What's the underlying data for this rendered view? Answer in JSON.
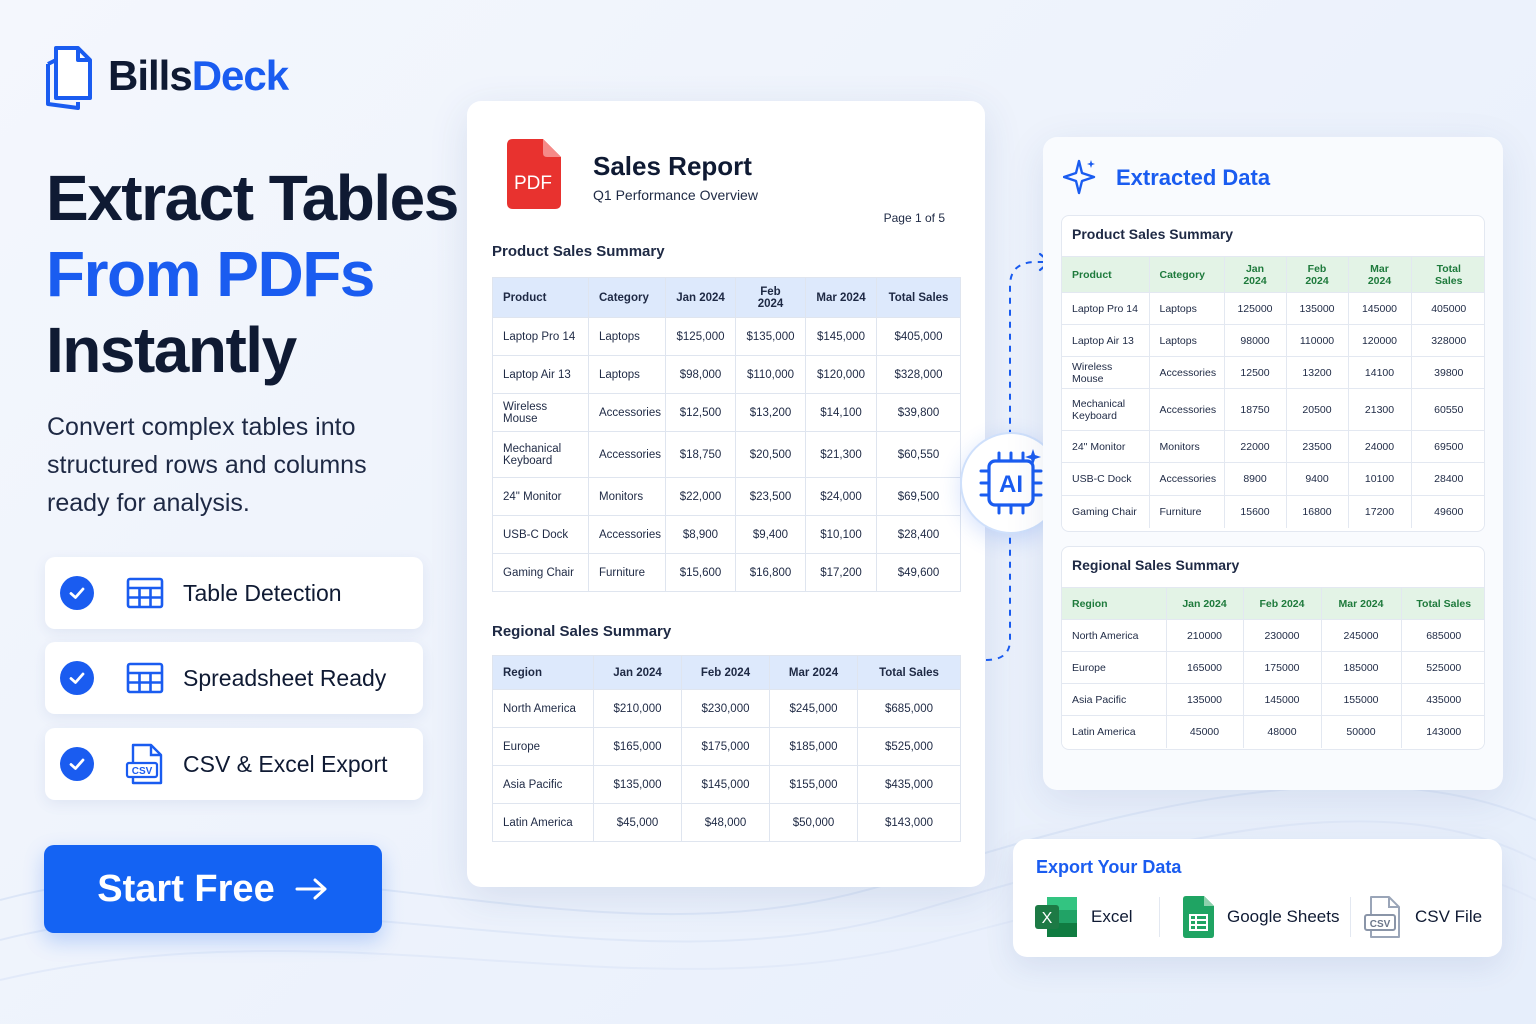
{
  "brand": {
    "name_part1": "Bills",
    "name_part2": "Deck"
  },
  "hero": {
    "line1": "Extract Tables",
    "line2": "From PDFs",
    "line3": "Instantly",
    "subtitle": "Convert complex tables into structured rows and columns ready for analysis."
  },
  "features": [
    {
      "label": "Table Detection",
      "icon": "table-icon"
    },
    {
      "label": "Spreadsheet Ready",
      "icon": "table-icon"
    },
    {
      "label": "CSV & Excel Export",
      "icon": "csv-file-icon",
      "icon_text": "CSV"
    }
  ],
  "cta": {
    "label": "Start Free"
  },
  "pdf": {
    "icon_text": "PDF",
    "title": "Sales Report",
    "subtitle": "Q1 Performance Overview",
    "page": "Page 1 of 5",
    "product_title": "Product Sales Summary",
    "product_headers": [
      "Product",
      "Category",
      "Jan 2024",
      "Feb 2024",
      "Mar 2024",
      "Total Sales"
    ],
    "product_rows": [
      [
        "Laptop Pro 14",
        "Laptops",
        "$125,000",
        "$135,000",
        "$145,000",
        "$405,000"
      ],
      [
        "Laptop Air 13",
        "Laptops",
        "$98,000",
        "$110,000",
        "$120,000",
        "$328,000"
      ],
      [
        "Wireless Mouse",
        "Accessories",
        "$12,500",
        "$13,200",
        "$14,100",
        "$39,800"
      ],
      [
        "Mechanical Keyboard",
        "Accessories",
        "$18,750",
        "$20,500",
        "$21,300",
        "$60,550"
      ],
      [
        "24\" Monitor",
        "Monitors",
        "$22,000",
        "$23,500",
        "$24,000",
        "$69,500"
      ],
      [
        "USB-C Dock",
        "Accessories",
        "$8,900",
        "$9,400",
        "$10,100",
        "$28,400"
      ],
      [
        "Gaming Chair",
        "Furniture",
        "$15,600",
        "$16,800",
        "$17,200",
        "$49,600"
      ]
    ],
    "regional_title": "Regional Sales Summary",
    "regional_headers": [
      "Region",
      "Jan 2024",
      "Feb 2024",
      "Mar 2024",
      "Total Sales"
    ],
    "regional_rows": [
      [
        "North America",
        "$210,000",
        "$230,000",
        "$245,000",
        "$685,000"
      ],
      [
        "Europe",
        "$165,000",
        "$175,000",
        "$185,000",
        "$525,000"
      ],
      [
        "Asia Pacific",
        "$135,000",
        "$145,000",
        "$155,000",
        "$435,000"
      ],
      [
        "Latin America",
        "$45,000",
        "$48,000",
        "$50,000",
        "$143,000"
      ]
    ]
  },
  "ai_badge": {
    "label": "AI"
  },
  "extracted": {
    "title": "Extracted Data",
    "product_title": "Product Sales Summary",
    "product_headers": [
      "Product",
      "Category",
      "Jan 2024",
      "Feb 2024",
      "Mar 2024",
      "Total Sales"
    ],
    "product_rows": [
      [
        "Laptop Pro 14",
        "Laptops",
        "125000",
        "135000",
        "145000",
        "405000"
      ],
      [
        "Laptop Air 13",
        "Laptops",
        "98000",
        "110000",
        "120000",
        "328000"
      ],
      [
        "Wireless Mouse",
        "Accessories",
        "12500",
        "13200",
        "14100",
        "39800"
      ],
      [
        "Mechanical Keyboard",
        "Accessories",
        "18750",
        "20500",
        "21300",
        "60550"
      ],
      [
        "24\" Monitor",
        "Monitors",
        "22000",
        "23500",
        "24000",
        "69500"
      ],
      [
        "USB-C Dock",
        "Accessories",
        "8900",
        "9400",
        "10100",
        "28400"
      ],
      [
        "Gaming Chair",
        "Furniture",
        "15600",
        "16800",
        "17200",
        "49600"
      ]
    ],
    "regional_title": "Regional Sales Summary",
    "regional_headers": [
      "Region",
      "Jan 2024",
      "Feb 2024",
      "Mar 2024",
      "Total Sales"
    ],
    "regional_rows": [
      [
        "North America",
        "210000",
        "230000",
        "245000",
        "685000"
      ],
      [
        "Europe",
        "165000",
        "175000",
        "185000",
        "525000"
      ],
      [
        "Asia Pacific",
        "135000",
        "145000",
        "155000",
        "435000"
      ],
      [
        "Latin America",
        "45000",
        "48000",
        "50000",
        "143000"
      ]
    ]
  },
  "export": {
    "title": "Export Your Data",
    "items": [
      {
        "label": "Excel",
        "icon": "excel-icon",
        "icon_text": "X"
      },
      {
        "label": "Google Sheets",
        "icon": "google-sheets-icon"
      },
      {
        "label": "CSV File",
        "icon": "csv-file-icon",
        "icon_text": "CSV"
      }
    ]
  },
  "colors": {
    "brand_blue": "#1a5cf0",
    "cta_blue": "#1463f3",
    "pdf_red": "#e8322f",
    "extracted_header_green": "#1e7a3c",
    "excel_green": "#1d7a45",
    "sheets_green": "#1fa463"
  }
}
